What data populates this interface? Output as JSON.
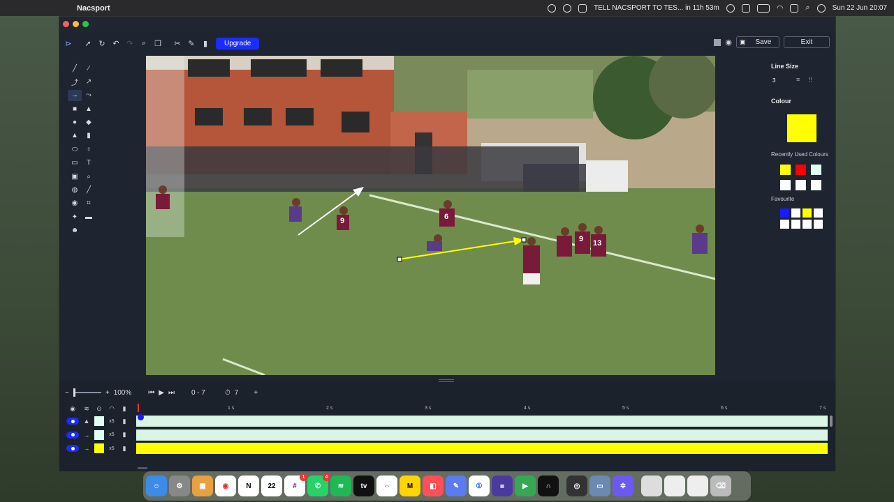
{
  "menubar": {
    "app_name": "Nacsport",
    "notification": "TELL NACSPORT TO TES... in 11h 53m",
    "datetime": "Sun 22 Jun  20:07"
  },
  "toolbar": {
    "upgrade_label": "Upgrade",
    "save_label": "Save",
    "exit_label": "Exit"
  },
  "right_panel": {
    "line_size_label": "Line Size",
    "line_size_value": "3",
    "colour_label": "Colour",
    "current_colour": "#ffff00",
    "recent_label": "Recently Used Colours",
    "recent_colours": [
      "#ffff00",
      "#ff0000",
      "#e0fff0",
      "#ffffff",
      "#ffffff",
      "#ffffff"
    ],
    "favourite_label": "Favourite",
    "favourite_colours": [
      "#1a1aff",
      "#ffffff",
      "#ffff00",
      "#ffffff",
      "#ffffff",
      "#ffffff",
      "#ffffff",
      "#ffffff"
    ]
  },
  "timeline": {
    "zoom": "100%",
    "range": "0 - 7",
    "duration": "7",
    "ticks": [
      "1 s",
      "2 s",
      "3 s",
      "4 s",
      "5 s",
      "6 s",
      "7 s"
    ],
    "rows": [
      {
        "multiplier": "x5",
        "color": "#e0fff0",
        "track_color": "#d9f5e3"
      },
      {
        "multiplier": "x5",
        "color": "#e0fff0",
        "track_color": "#d9f5e3"
      },
      {
        "multiplier": "x5",
        "color": "#ffff00",
        "track_color": "#ffff00"
      }
    ]
  },
  "video": {
    "player_numbers": [
      "9",
      "6",
      "9",
      "13"
    ]
  },
  "dock": {
    "calendar_day": "22",
    "slack_badge": "1",
    "whatsapp_badge": "4"
  }
}
